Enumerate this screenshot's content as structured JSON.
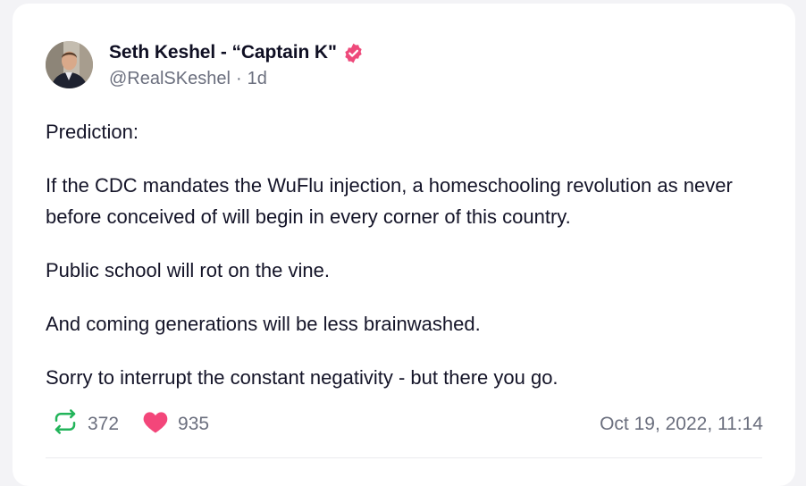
{
  "post": {
    "author": {
      "display_name": "Seth Keshel - “Captain K\"",
      "handle": "@RealSKeshel",
      "verified": true
    },
    "age": "1d",
    "separator": "·",
    "paragraphs": [
      "Prediction:",
      "If the CDC mandates the WuFlu injection, a homeschooling revolution as never before conceived of will begin in every corner of this country.",
      "Public school will rot on the vine.",
      "And coming generations will be less brainwashed.",
      "Sorry to interrupt the constant negativity - but there you go."
    ],
    "stats": {
      "reposts": "372",
      "likes": "935"
    },
    "timestamp": "Oct 19, 2022, 11:14"
  },
  "icons": {
    "verified": "verified-badge-icon",
    "repost": "repost-icon",
    "like": "heart-icon"
  },
  "colors": {
    "verified": "#ee4a7b",
    "repost": "#22b45a",
    "like": "#f3467a",
    "text": "#141428",
    "muted": "#6b6f7e"
  }
}
